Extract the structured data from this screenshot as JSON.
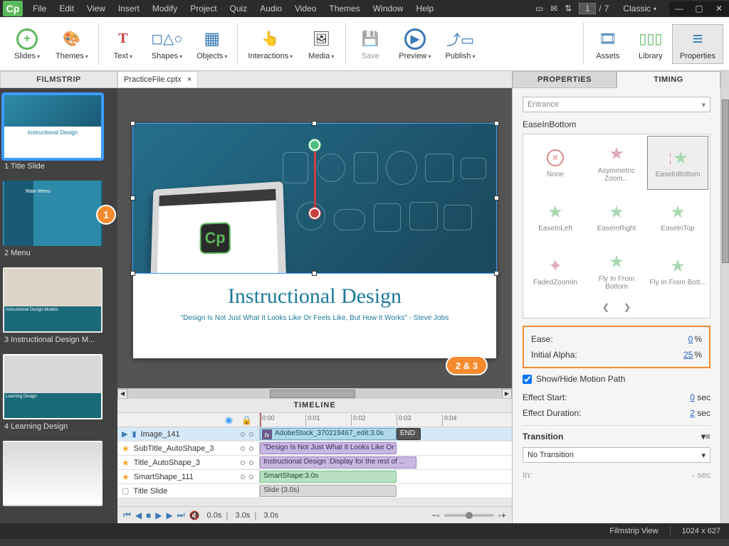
{
  "app_icon": "Cp",
  "menu": [
    "File",
    "Edit",
    "View",
    "Insert",
    "Modify",
    "Project",
    "Quiz",
    "Audio",
    "Video",
    "Themes",
    "Window",
    "Help"
  ],
  "page": {
    "current": "1",
    "total": "7"
  },
  "workspace": "Classic",
  "ribbon": {
    "slides": "Slides",
    "themes": "Themes",
    "text": "Text",
    "shapes": "Shapes",
    "objects": "Objects",
    "interactions": "Interactions",
    "media": "Media",
    "save": "Save",
    "preview": "Preview",
    "publish": "Publish",
    "assets": "Assets",
    "library": "Library",
    "properties": "Properties"
  },
  "filmstrip": {
    "title": "FILMSTRIP",
    "items": [
      {
        "label": "1 Title Slide"
      },
      {
        "label": "2 Menu"
      },
      {
        "label": "3 Instructional Design M..."
      },
      {
        "label": "4 Learning Design"
      }
    ]
  },
  "doc_tab": "PracticeFile.cptx",
  "slide": {
    "title": "Instructional Design",
    "subtitle": "\"Design Is Not Just What It Looks Like Or Feels Like, But How It Works\" - Steve Jobs"
  },
  "timeline": {
    "title": "TIMELINE",
    "ticks": [
      "0:00",
      "0:01",
      "0:02",
      "0:03",
      "0:04"
    ],
    "end": "END",
    "rows": [
      {
        "name": "Image_141",
        "bar": "AdobeStock_370219467_edit:3.0s",
        "style": "blue",
        "fx": true,
        "star": "blue"
      },
      {
        "name": "SubTitle_AutoShape_3",
        "bar": "\"Design Is Not Just What It Looks Like Or F...",
        "style": "purple",
        "star": "gold"
      },
      {
        "name": "Title_AutoShape_3",
        "bar": "Instructional Design :Display for the rest of ...",
        "style": "purple",
        "star": "gold"
      },
      {
        "name": "SmartShape_111",
        "bar": "SmartShape:3.0s",
        "style": "green",
        "star": "gold"
      },
      {
        "name": "Title Slide",
        "bar": "Slide (3.0s)",
        "style": "grey",
        "star": "none"
      }
    ],
    "controls_time": {
      "cur": "0.0s",
      "dur": "3.0s",
      "end": "3.0s"
    }
  },
  "props": {
    "tab_properties": "PROPERTIES",
    "tab_timing": "TIMING",
    "entrance": "Entrance",
    "effect_name": "EaseInBottom",
    "cells": [
      "None",
      "Asymmetric Zoom...",
      "EaseInBottom",
      "EaseInLeft",
      "EaseInRight",
      "EaseInTop",
      "FadedZoomIn",
      "Fly In  From Bottom",
      "Fly In  From Bott..."
    ],
    "ease_label": "Ease:",
    "ease_val": "0",
    "ease_unit": "%",
    "alpha_label": "Initial Alpha:",
    "alpha_val": "25",
    "alpha_unit": "%",
    "show_path": "Show/Hide Motion Path",
    "start_label": "Effect Start:",
    "start_val": "0",
    "start_unit": "sec",
    "dur_label": "Effect Duration:",
    "dur_val": "2",
    "dur_unit": "sec",
    "transition": "Transition",
    "trans_val": "No Transition",
    "in_label": "In:",
    "in_val": "- sec"
  },
  "annotations": {
    "a1": "1",
    "a23": "2 & 3"
  },
  "status": {
    "view": "Filmstrip View",
    "dims": "1024 x 627"
  }
}
